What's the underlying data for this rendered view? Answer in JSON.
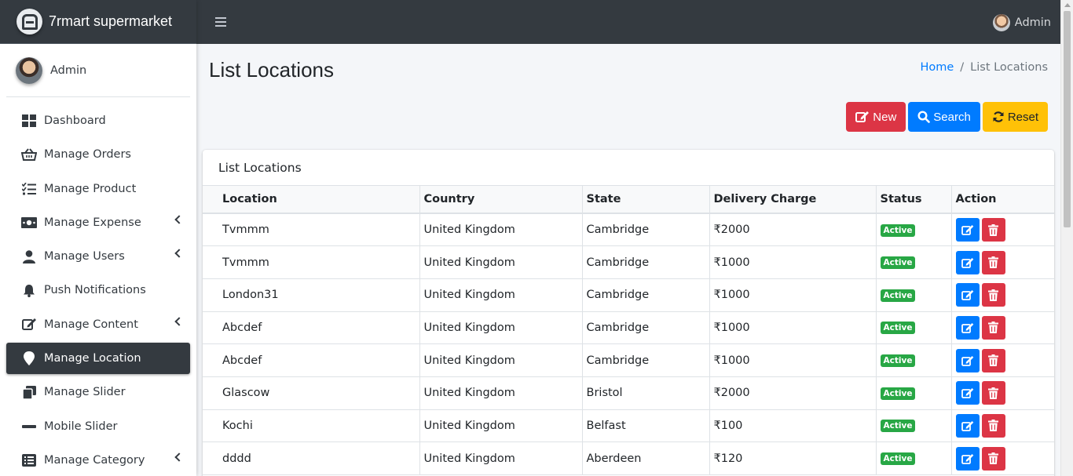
{
  "brand": {
    "name": "7rmart supermarket"
  },
  "sidebar": {
    "user": "Admin",
    "items": [
      {
        "label": "Dashboard",
        "icon": "dashboard-icon",
        "expandable": false,
        "active": false
      },
      {
        "label": "Manage Orders",
        "icon": "basket-icon",
        "expandable": false,
        "active": false
      },
      {
        "label": "Manage Product",
        "icon": "tasks-icon",
        "expandable": false,
        "active": false
      },
      {
        "label": "Manage Expense",
        "icon": "money-bill-icon",
        "expandable": true,
        "active": false
      },
      {
        "label": "Manage Users",
        "icon": "user-icon",
        "expandable": true,
        "active": false
      },
      {
        "label": "Push Notifications",
        "icon": "bell-icon",
        "expandable": false,
        "active": false
      },
      {
        "label": "Manage Content",
        "icon": "edit-icon",
        "expandable": true,
        "active": false
      },
      {
        "label": "Manage Location",
        "icon": "map-marker-icon",
        "expandable": false,
        "active": true
      },
      {
        "label": "Manage Slider",
        "icon": "clone-icon",
        "expandable": false,
        "active": false
      },
      {
        "label": "Mobile Slider",
        "icon": "minus-icon",
        "expandable": false,
        "active": false
      },
      {
        "label": "Manage Category",
        "icon": "list-alt-icon",
        "expandable": true,
        "active": false
      }
    ]
  },
  "topbar": {
    "user": "Admin"
  },
  "page": {
    "title": "List Locations",
    "breadcrumb": {
      "home": "Home",
      "separator": "/",
      "current": "List Locations"
    }
  },
  "buttons": {
    "new": "New",
    "search": "Search",
    "reset": "Reset"
  },
  "card": {
    "title": "List Locations"
  },
  "table": {
    "headers": [
      "Location",
      "Country",
      "State",
      "Delivery Charge",
      "Status",
      "Action"
    ],
    "rows": [
      {
        "location": "Tvmmm",
        "country": "United Kingdom",
        "state": "Cambridge",
        "charge": "₹2000",
        "status": "Active"
      },
      {
        "location": "Tvmmm",
        "country": "United Kingdom",
        "state": "Cambridge",
        "charge": "₹1000",
        "status": "Active"
      },
      {
        "location": "London31",
        "country": "United Kingdom",
        "state": "Cambridge",
        "charge": "₹1000",
        "status": "Active"
      },
      {
        "location": "Abcdef",
        "country": "United Kingdom",
        "state": "Cambridge",
        "charge": "₹1000",
        "status": "Active"
      },
      {
        "location": "Abcdef",
        "country": "United Kingdom",
        "state": "Cambridge",
        "charge": "₹1000",
        "status": "Active"
      },
      {
        "location": "Glascow",
        "country": "United Kingdom",
        "state": "Bristol",
        "charge": "₹2000",
        "status": "Active"
      },
      {
        "location": "Kochi",
        "country": "United Kingdom",
        "state": "Belfast",
        "charge": "₹100",
        "status": "Active"
      },
      {
        "location": "dddd",
        "country": "United Kingdom",
        "state": "Aberdeen",
        "charge": "₹120",
        "status": "Active"
      }
    ]
  },
  "colors": {
    "dark": "#343a40",
    "primary": "#007bff",
    "danger": "#dc3545",
    "warning": "#ffc107",
    "success": "#28a745"
  }
}
